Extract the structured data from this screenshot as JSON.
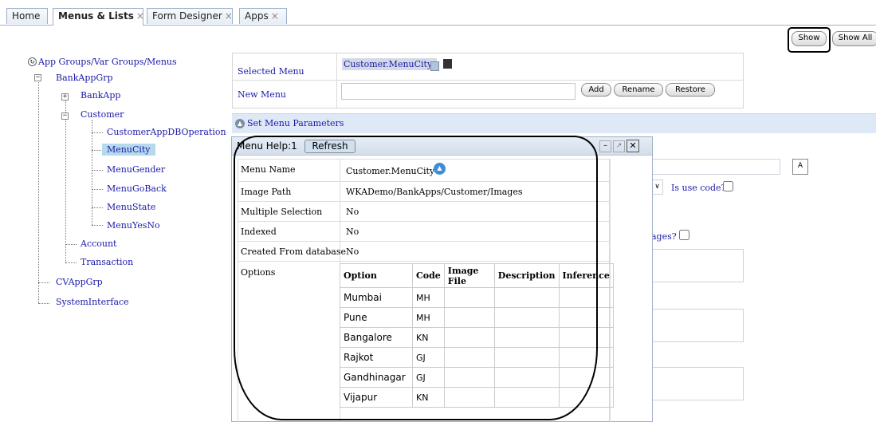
{
  "tabs": [
    {
      "label": "Home",
      "closable": false
    },
    {
      "label": "Menus & Lists",
      "closable": true,
      "active": true
    },
    {
      "label": "Form Designer",
      "closable": true
    },
    {
      "label": "Apps",
      "closable": true
    }
  ],
  "close_glyph": "×",
  "buttons": {
    "show": "Show",
    "show_all": "Show All"
  },
  "tree": {
    "root": "App Groups/Var Groups/Menus",
    "bankappgrp": "BankAppGrp",
    "bankapp": "BankApp",
    "customer": "Customer",
    "customer_items": [
      "CustomerAppDBOperation",
      "MenuCity",
      "MenuGender",
      "MenuGoBack",
      "MenuState",
      "MenuYesNo"
    ],
    "account": "Account",
    "transaction": "Transaction",
    "cvappgrp": "CVAppGrp",
    "systeminterface": "SystemInterface"
  },
  "form": {
    "selected_menu_label": "Selected Menu",
    "selected_menu_value": "Customer.MenuCity:",
    "new_menu_label": "New Menu",
    "new_menu_value": "",
    "add": "Add",
    "rename": "Rename",
    "restore": "Restore"
  },
  "params_bar": "Set Menu Parameters",
  "right_side": {
    "is_use_code": "Is use code?",
    "images_partial": "ages?"
  },
  "dialog": {
    "title": "Menu Help:1",
    "refresh": "Refresh",
    "rows": [
      {
        "label": "Menu Name",
        "value": "Customer.MenuCity"
      },
      {
        "label": "Image Path",
        "value": "WKADemo/BankApps/Customer/Images"
      },
      {
        "label": "Multiple Selection",
        "value": "No"
      },
      {
        "label": "Indexed",
        "value": "No"
      },
      {
        "label": "Created From database",
        "value": "No"
      }
    ],
    "options_label": "Options",
    "options_headers": [
      "Option",
      "Code",
      "Image File",
      "Description",
      "Inference"
    ],
    "options_rows": [
      [
        "Mumbai",
        "MH",
        "",
        "",
        ""
      ],
      [
        "Pune",
        "MH",
        "",
        "",
        ""
      ],
      [
        "Bangalore",
        "KN",
        "",
        "",
        ""
      ],
      [
        "Rajkot",
        "GJ",
        "",
        "",
        ""
      ],
      [
        "Gandhinagar",
        "GJ",
        "",
        "",
        ""
      ],
      [
        "Vijapur",
        "KN",
        "",
        "",
        ""
      ]
    ]
  }
}
